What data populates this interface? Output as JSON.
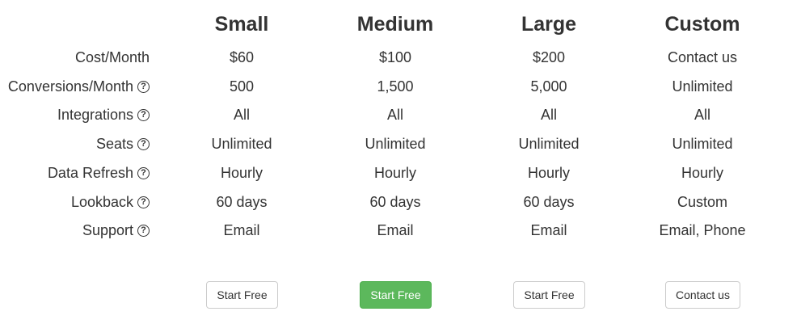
{
  "plans": [
    {
      "name": "Small",
      "button_label": "Start Free"
    },
    {
      "name": "Medium",
      "button_label": "Start Free"
    },
    {
      "name": "Large",
      "button_label": "Start Free"
    },
    {
      "name": "Custom",
      "button_label": "Contact us"
    }
  ],
  "rows": [
    {
      "label": "Cost/Month",
      "has_help_icon": false,
      "values": [
        "$60",
        "$100",
        "$200",
        "Contact us"
      ]
    },
    {
      "label": "Conversions/Month",
      "has_help_icon": true,
      "values": [
        "500",
        "1,500",
        "5,000",
        "Unlimited"
      ]
    },
    {
      "label": "Integrations",
      "has_help_icon": true,
      "values": [
        "All",
        "All",
        "All",
        "All"
      ]
    },
    {
      "label": "Seats",
      "has_help_icon": true,
      "values": [
        "Unlimited",
        "Unlimited",
        "Unlimited",
        "Unlimited"
      ]
    },
    {
      "label": "Data Refresh",
      "has_help_icon": true,
      "values": [
        "Hourly",
        "Hourly",
        "Hourly",
        "Hourly"
      ]
    },
    {
      "label": "Lookback",
      "has_help_icon": true,
      "values": [
        "60 days",
        "60 days",
        "60 days",
        "Custom"
      ]
    },
    {
      "label": "Support",
      "has_help_icon": true,
      "values": [
        "Email",
        "Email",
        "Email",
        "Email, Phone"
      ]
    }
  ],
  "help_icon_glyph": "?",
  "colors": {
    "text": "#333333",
    "primary_button": "#5cb85c",
    "button_border": "#cccccc"
  }
}
